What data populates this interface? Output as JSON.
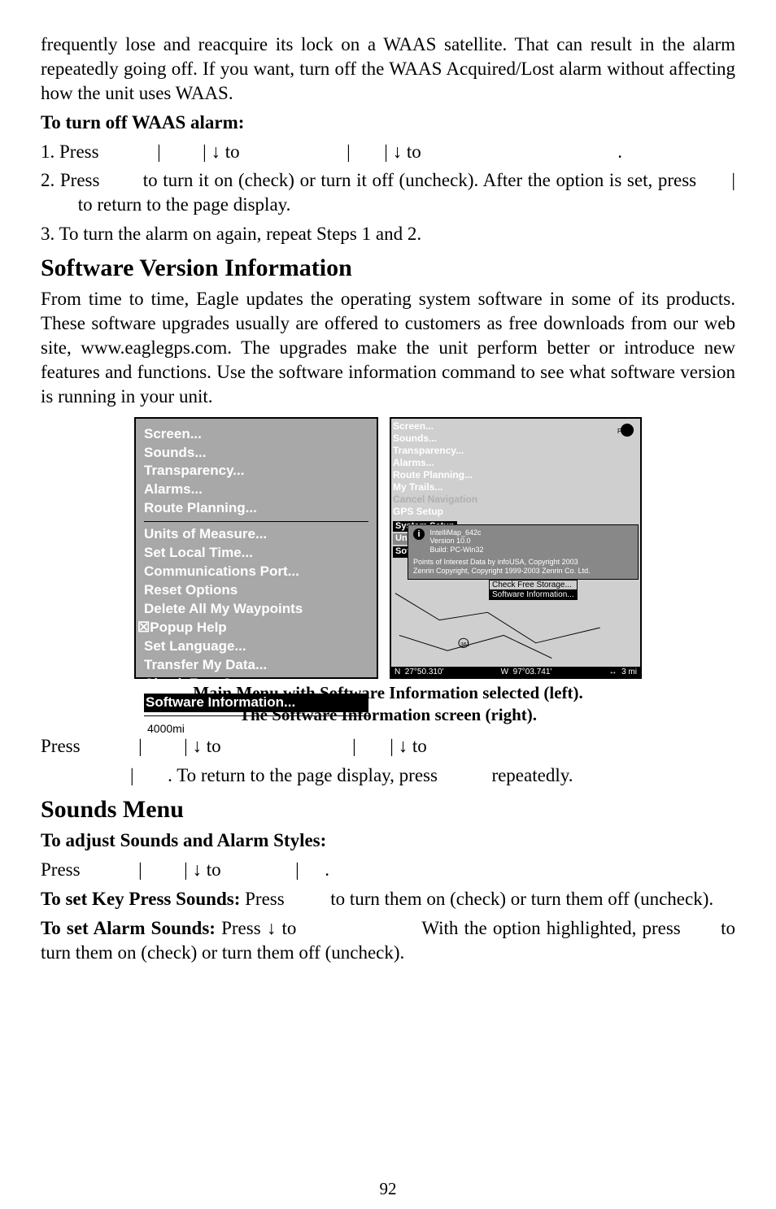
{
  "pageNumber": "92",
  "p1": "frequently lose and reacquire its lock on a WAAS satellite. That can result in the alarm repeatedly going off. If you want, turn off the WAAS Acquired/Lost alarm without affecting how the unit uses WAAS.",
  "h_turnoff": "To turn off WAAS alarm:",
  "s1_a": "1. Press ",
  "s1_b": "|",
  "s1_c": "|",
  "s1_d": " to ",
  "s1_e": "|",
  "s1_f": "|",
  "s1_g": " to ",
  "s1_h": ".",
  "s2_a": "2. Press ",
  "s2_b": " to turn it on (check) or turn it off (uncheck). After the option is set, press ",
  "s2_c": "|",
  "s2_d": " to return to the page display.",
  "s3": "3. To turn the alarm on again, repeat Steps 1 and 2.",
  "h_svi": "Software Version Information",
  "p_svi": "From time to time, Eagle updates the operating system software in some of its products. These software upgrades usually are offered to customers as free downloads from our web site, www.eaglegps.com. The upgrades make the unit perform better or introduce new features and functions. Use the software information command to see what software version is running in your unit.",
  "left_menu": {
    "groupA": [
      "Screen...",
      "Sounds...",
      "Transparency...",
      "Alarms...",
      "Route Planning..."
    ],
    "groupB": [
      "Units of Measure...",
      "Set Local Time...",
      "Communications Port...",
      "Reset Options",
      "Delete All My Waypoints"
    ],
    "popup": "Popup Help",
    "groupC": [
      "Set Language...",
      "Transfer My Data...",
      "Check Free Storage..."
    ],
    "highlight": "Software Information...",
    "footer": "4000mi"
  },
  "right_menu": {
    "items": [
      "Screen...",
      "Sounds...",
      "Transparency...",
      "Alarms...",
      "Route Planning...",
      "My Trails..."
    ],
    "dim": "Cancel Navigation",
    "last": "GPS Setup",
    "tab1": "System Setup",
    "tab2": "Units of Measure...",
    "info_head": "Software Information",
    "info1": "IntelliMap_642c",
    "info2": "Version 10.0",
    "info3": "Build: PC-Win32",
    "info4": "Points of Interest Data by infoUSA, Copyright 2003",
    "info5": "Zenrin Copyright, Copyright 1999-2003 Zenrin Co. Ltd.",
    "sub1": "Check Free Storage...",
    "sub2": "Software Information...",
    "status_n": "N",
    "status_lat": "27°50.310'",
    "status_w": "W",
    "status_lon": "97°03.741'",
    "status_arrow": "↔",
    "status_scale": "3 mi",
    "pass": "Pass"
  },
  "caption1": "Main Menu with Software Information selected (left).",
  "caption2": "The Software Information screen (right).",
  "press_a": "Press ",
  "press_b": "|",
  "press_c": "|",
  "press_d": " to ",
  "press_e": "|",
  "press_f": "|",
  "press_g": " to ",
  "press2_a": "|",
  "press2_b": ". To return to the page display, press ",
  "press2_c": " repeatedly.",
  "h_sounds": "Sounds Menu",
  "h_adjust": "To adjust Sounds and Alarm Styles:",
  "ps_a": "Press ",
  "ps_b": "|",
  "ps_c": "|",
  "ps_d": " to ",
  "ps_e": "|",
  "ps_f": ".",
  "kp_a": "To set Key Press Sounds:",
  "kp_b": " Press ",
  "kp_c": " to turn them on (check) or turn them off (uncheck).",
  "as_a": "To set Alarm Sounds:",
  "as_b": " Press ",
  "as_c": " to ",
  "as_d": " With the option highlighted, press ",
  "as_e": " to turn them on (check) or turn them off (uncheck).",
  "arrow_down": "↓"
}
